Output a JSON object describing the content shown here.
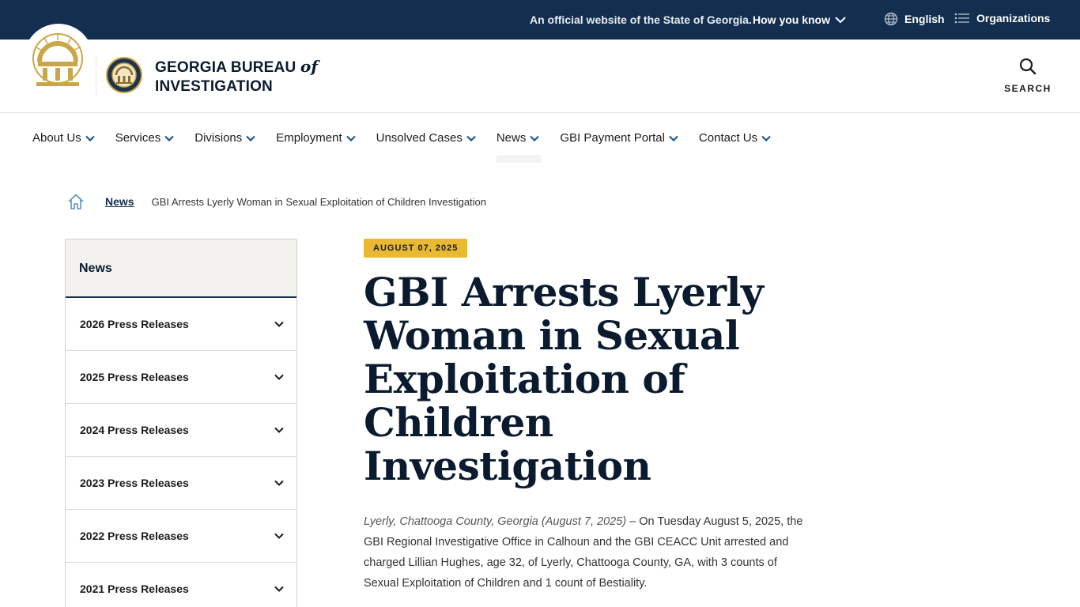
{
  "topbar": {
    "official_text": "An official website of the State of Georgia.",
    "how_you_know": "How you know",
    "language": "English",
    "organizations": "Organizations"
  },
  "header": {
    "title_line1": "GEORGIA BUREAU",
    "title_of": "of",
    "title_line2": "INVESTIGATION",
    "search_label": "SEARCH"
  },
  "nav": {
    "items": [
      {
        "label": "About Us"
      },
      {
        "label": "Services"
      },
      {
        "label": "Divisions"
      },
      {
        "label": "Employment"
      },
      {
        "label": "Unsolved Cases"
      },
      {
        "label": "News"
      },
      {
        "label": "GBI Payment Portal"
      },
      {
        "label": "Contact Us"
      }
    ],
    "active": "News"
  },
  "breadcrumb": {
    "link": "News",
    "current": "GBI Arrests Lyerly Woman in Sexual Exploitation of Children Investigation"
  },
  "sidebar": {
    "heading": "News",
    "items": [
      {
        "label": "2026 Press Releases"
      },
      {
        "label": "2025 Press Releases"
      },
      {
        "label": "2024 Press Releases"
      },
      {
        "label": "2023 Press Releases"
      },
      {
        "label": "2022 Press Releases"
      },
      {
        "label": "2021 Press Releases"
      }
    ]
  },
  "article": {
    "date": "AUGUST 07, 2025",
    "title": "GBI Arrests Lyerly Woman in Sexual Exploitation of Children Investigation",
    "dateline": "Lyerly, Chattooga County, Georgia (August 7, 2025)",
    "body": " – On Tuesday August 5, 2025, the GBI Regional Investigative Office in Calhoun and the GBI CEACC Unit arrested and charged Lillian Hughes, age 32, of Lyerly, Chattooga County, GA, with 3 counts of Sexual Exploitation of Children and 1 count of Bestiality."
  },
  "colors": {
    "navy": "#132e4f",
    "gold": "#e8b931",
    "sidebar_head_bg": "#f3f2ee"
  },
  "icons": {
    "how_you_know": "chevron-down-icon",
    "language": "globe-icon",
    "organizations": "list-icon",
    "search": "search-icon",
    "breadcrumb_home": "home-icon",
    "sidebar_expand": "chevron-down-icon",
    "seal_state": "georgia-state-seal",
    "seal_agency": "gbi-seal"
  }
}
